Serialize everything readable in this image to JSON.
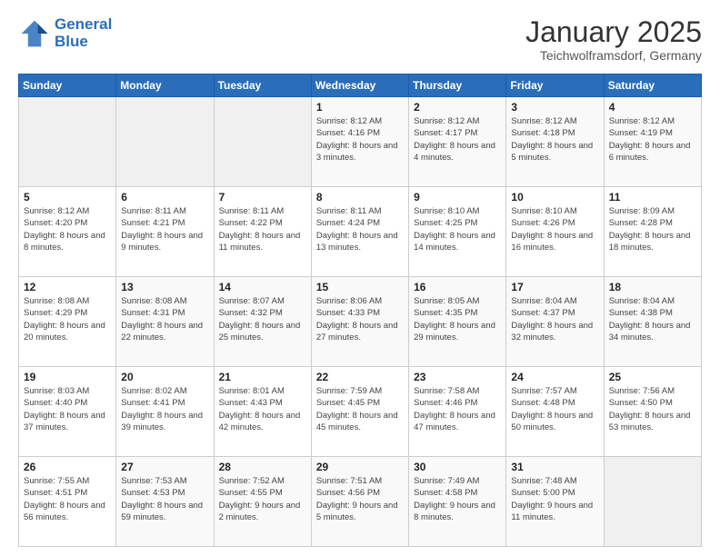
{
  "logo": {
    "line1": "General",
    "line2": "Blue"
  },
  "header": {
    "title": "January 2025",
    "subtitle": "Teichwolframsdorf, Germany"
  },
  "weekdays": [
    "Sunday",
    "Monday",
    "Tuesday",
    "Wednesday",
    "Thursday",
    "Friday",
    "Saturday"
  ],
  "weeks": [
    [
      {
        "day": "",
        "info": ""
      },
      {
        "day": "",
        "info": ""
      },
      {
        "day": "",
        "info": ""
      },
      {
        "day": "1",
        "info": "Sunrise: 8:12 AM\nSunset: 4:16 PM\nDaylight: 8 hours\nand 3 minutes."
      },
      {
        "day": "2",
        "info": "Sunrise: 8:12 AM\nSunset: 4:17 PM\nDaylight: 8 hours\nand 4 minutes."
      },
      {
        "day": "3",
        "info": "Sunrise: 8:12 AM\nSunset: 4:18 PM\nDaylight: 8 hours\nand 5 minutes."
      },
      {
        "day": "4",
        "info": "Sunrise: 8:12 AM\nSunset: 4:19 PM\nDaylight: 8 hours\nand 6 minutes."
      }
    ],
    [
      {
        "day": "5",
        "info": "Sunrise: 8:12 AM\nSunset: 4:20 PM\nDaylight: 8 hours\nand 8 minutes."
      },
      {
        "day": "6",
        "info": "Sunrise: 8:11 AM\nSunset: 4:21 PM\nDaylight: 8 hours\nand 9 minutes."
      },
      {
        "day": "7",
        "info": "Sunrise: 8:11 AM\nSunset: 4:22 PM\nDaylight: 8 hours\nand 11 minutes."
      },
      {
        "day": "8",
        "info": "Sunrise: 8:11 AM\nSunset: 4:24 PM\nDaylight: 8 hours\nand 13 minutes."
      },
      {
        "day": "9",
        "info": "Sunrise: 8:10 AM\nSunset: 4:25 PM\nDaylight: 8 hours\nand 14 minutes."
      },
      {
        "day": "10",
        "info": "Sunrise: 8:10 AM\nSunset: 4:26 PM\nDaylight: 8 hours\nand 16 minutes."
      },
      {
        "day": "11",
        "info": "Sunrise: 8:09 AM\nSunset: 4:28 PM\nDaylight: 8 hours\nand 18 minutes."
      }
    ],
    [
      {
        "day": "12",
        "info": "Sunrise: 8:08 AM\nSunset: 4:29 PM\nDaylight: 8 hours\nand 20 minutes."
      },
      {
        "day": "13",
        "info": "Sunrise: 8:08 AM\nSunset: 4:31 PM\nDaylight: 8 hours\nand 22 minutes."
      },
      {
        "day": "14",
        "info": "Sunrise: 8:07 AM\nSunset: 4:32 PM\nDaylight: 8 hours\nand 25 minutes."
      },
      {
        "day": "15",
        "info": "Sunrise: 8:06 AM\nSunset: 4:33 PM\nDaylight: 8 hours\nand 27 minutes."
      },
      {
        "day": "16",
        "info": "Sunrise: 8:05 AM\nSunset: 4:35 PM\nDaylight: 8 hours\nand 29 minutes."
      },
      {
        "day": "17",
        "info": "Sunrise: 8:04 AM\nSunset: 4:37 PM\nDaylight: 8 hours\nand 32 minutes."
      },
      {
        "day": "18",
        "info": "Sunrise: 8:04 AM\nSunset: 4:38 PM\nDaylight: 8 hours\nand 34 minutes."
      }
    ],
    [
      {
        "day": "19",
        "info": "Sunrise: 8:03 AM\nSunset: 4:40 PM\nDaylight: 8 hours\nand 37 minutes."
      },
      {
        "day": "20",
        "info": "Sunrise: 8:02 AM\nSunset: 4:41 PM\nDaylight: 8 hours\nand 39 minutes."
      },
      {
        "day": "21",
        "info": "Sunrise: 8:01 AM\nSunset: 4:43 PM\nDaylight: 8 hours\nand 42 minutes."
      },
      {
        "day": "22",
        "info": "Sunrise: 7:59 AM\nSunset: 4:45 PM\nDaylight: 8 hours\nand 45 minutes."
      },
      {
        "day": "23",
        "info": "Sunrise: 7:58 AM\nSunset: 4:46 PM\nDaylight: 8 hours\nand 47 minutes."
      },
      {
        "day": "24",
        "info": "Sunrise: 7:57 AM\nSunset: 4:48 PM\nDaylight: 8 hours\nand 50 minutes."
      },
      {
        "day": "25",
        "info": "Sunrise: 7:56 AM\nSunset: 4:50 PM\nDaylight: 8 hours\nand 53 minutes."
      }
    ],
    [
      {
        "day": "26",
        "info": "Sunrise: 7:55 AM\nSunset: 4:51 PM\nDaylight: 8 hours\nand 56 minutes."
      },
      {
        "day": "27",
        "info": "Sunrise: 7:53 AM\nSunset: 4:53 PM\nDaylight: 8 hours\nand 59 minutes."
      },
      {
        "day": "28",
        "info": "Sunrise: 7:52 AM\nSunset: 4:55 PM\nDaylight: 9 hours\nand 2 minutes."
      },
      {
        "day": "29",
        "info": "Sunrise: 7:51 AM\nSunset: 4:56 PM\nDaylight: 9 hours\nand 5 minutes."
      },
      {
        "day": "30",
        "info": "Sunrise: 7:49 AM\nSunset: 4:58 PM\nDaylight: 9 hours\nand 8 minutes."
      },
      {
        "day": "31",
        "info": "Sunrise: 7:48 AM\nSunset: 5:00 PM\nDaylight: 9 hours\nand 11 minutes."
      },
      {
        "day": "",
        "info": ""
      }
    ]
  ]
}
